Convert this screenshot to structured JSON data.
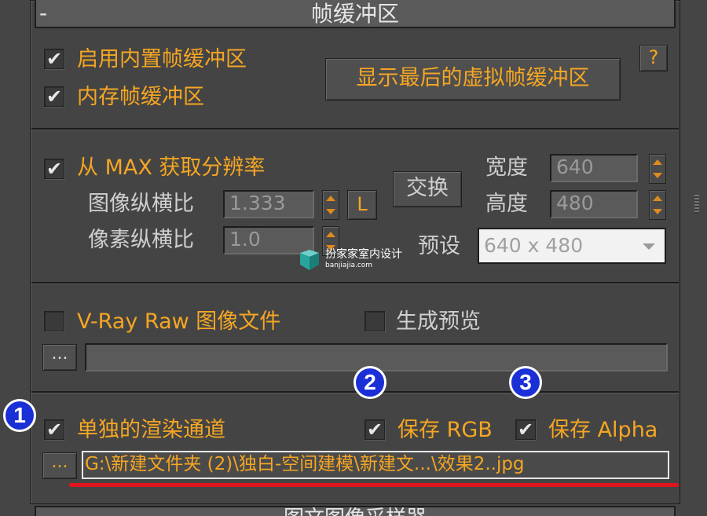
{
  "rollout": {
    "collapse_symbol": "-",
    "title": "帧缓冲区",
    "next_rollout_title": "图文图像采样器"
  },
  "framebuffer": {
    "enable_builtin": {
      "label": "启用内置帧缓冲区",
      "checked": true,
      "mark": "✔"
    },
    "memory_framebuffer": {
      "label": "内存帧缓冲区",
      "checked": true,
      "mark": "✔"
    },
    "show_last_vfb_label": "显示最后的虚拟帧缓冲区",
    "help_label": "?"
  },
  "resolution": {
    "get_from_max": {
      "label": "从 MAX 获取分辨率",
      "checked": true,
      "mark": "✔"
    },
    "image_aspect_label": "图像纵横比",
    "image_aspect_value": "1.333",
    "lock_label": "L",
    "pixel_aspect_label": "像素纵横比",
    "pixel_aspect_value": "1.0",
    "swap_label": "交换",
    "width_label": "宽度",
    "width_value": "640",
    "height_label": "高度",
    "height_value": "480",
    "preset_label": "预设",
    "preset_value": "640 x 480"
  },
  "raw": {
    "vray_raw": {
      "label": "V-Ray Raw 图像文件",
      "checked": false,
      "mark": ""
    },
    "generate_preview": {
      "label": "生成预览",
      "checked": false,
      "mark": ""
    },
    "browse_label": "...",
    "path_value": ""
  },
  "split": {
    "separate_channels": {
      "label": "单独的渲染通道",
      "checked": true,
      "mark": "✔"
    },
    "save_rgb": {
      "label": "保存 RGB",
      "checked": true,
      "mark": "✔"
    },
    "save_alpha": {
      "label": "保存 Alpha",
      "checked": true,
      "mark": "✔"
    },
    "browse_label": "...",
    "path_value": "G:\\新建文件夹 (2)\\独白-空间建模\\新建文...\\效果2..jpg"
  },
  "markers": [
    "1",
    "2",
    "3"
  ],
  "watermark": {
    "name": "扮家家室内设计",
    "url": "banjiajia.com"
  },
  "colors": {
    "accent_orange": "#f5a623",
    "marker_blue": "#1a2fd6",
    "underline_red": "#e0141e"
  }
}
